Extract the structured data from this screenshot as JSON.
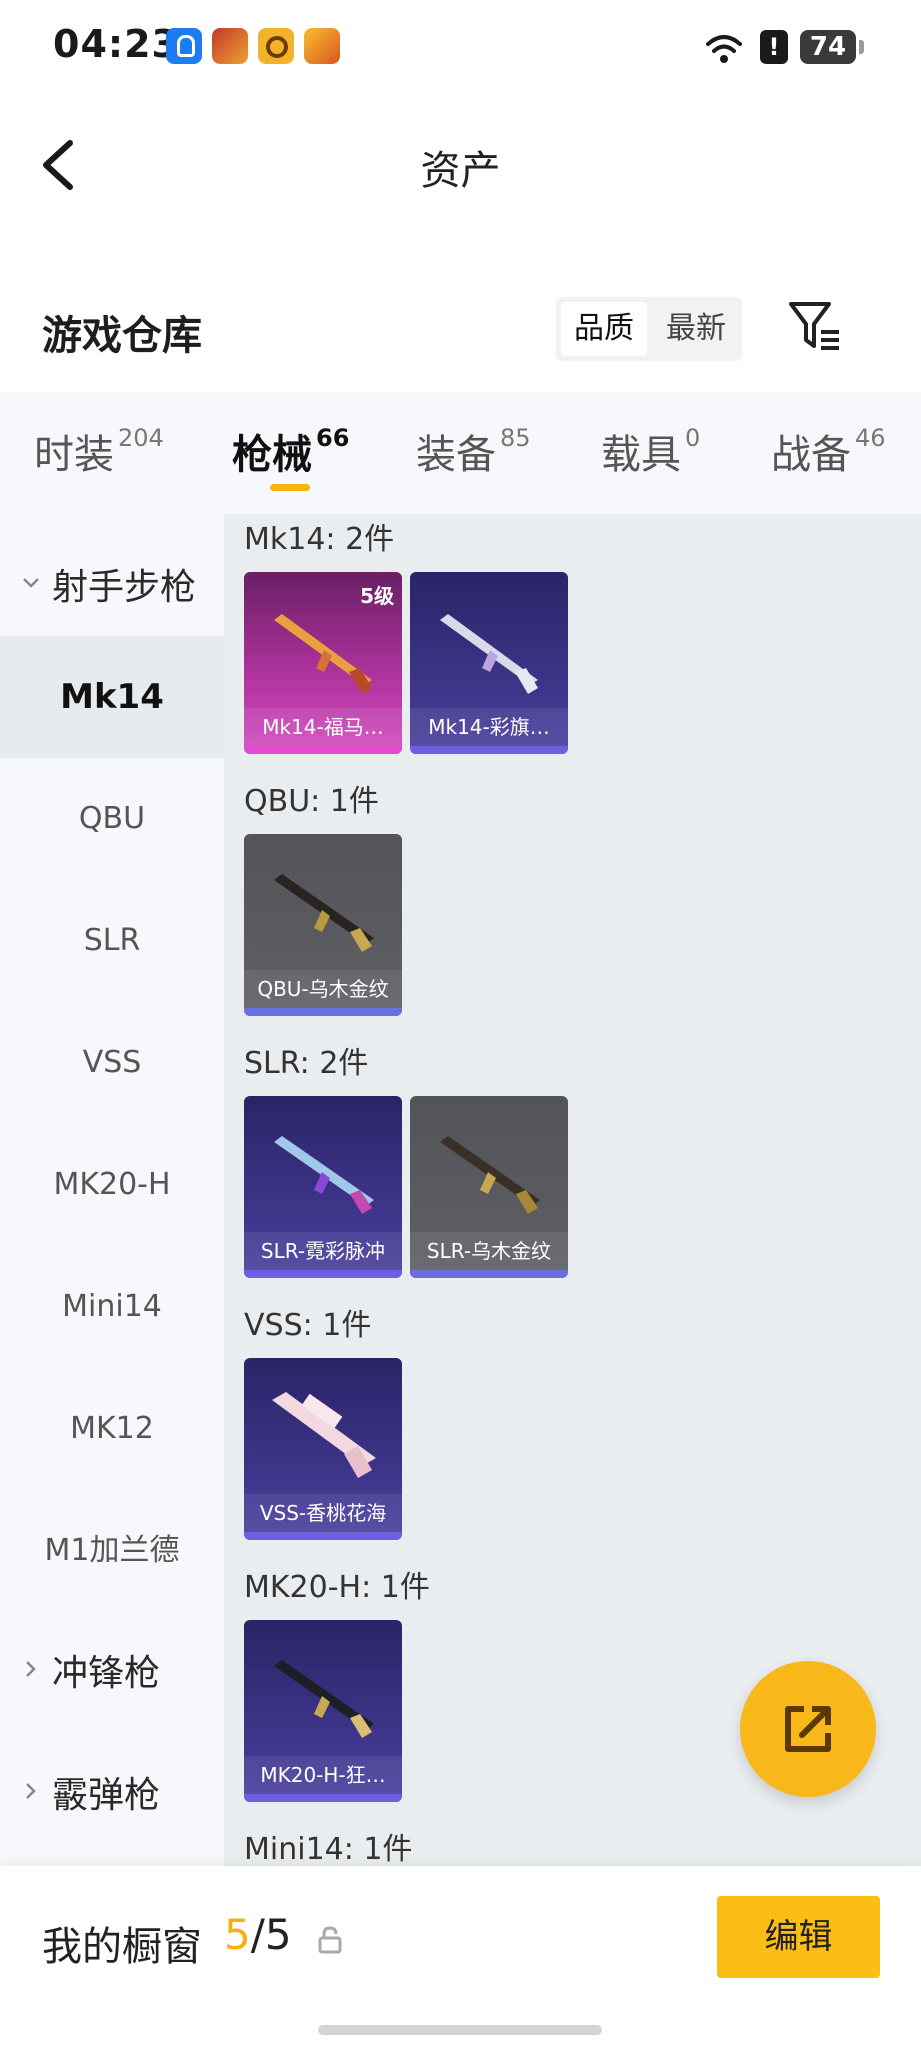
{
  "status_bar": {
    "time": "04:23",
    "battery": "74",
    "alert": "!"
  },
  "header": {
    "title": "资产"
  },
  "section": {
    "title": "游戏仓库",
    "sort_options": [
      "品质",
      "最新"
    ],
    "sort_selected": "品质"
  },
  "tabs": [
    {
      "label": "时装",
      "count": "204"
    },
    {
      "label": "枪械",
      "count": "66"
    },
    {
      "label": "装备",
      "count": "85"
    },
    {
      "label": "载具",
      "count": "0"
    },
    {
      "label": "战备",
      "count": "46"
    }
  ],
  "active_tab": "枪械",
  "sidebar": {
    "groups": [
      {
        "label": "射手步枪",
        "expanded": true
      },
      {
        "label": "冲锋枪",
        "expanded": false
      },
      {
        "label": "霰弹枪",
        "expanded": false
      }
    ],
    "items": [
      "Mk14",
      "QBU",
      "SLR",
      "VSS",
      "MK20-H",
      "Mini14",
      "MK12",
      "M1加兰德"
    ],
    "active_item": "Mk14"
  },
  "groups": [
    {
      "title": "Mk14: 2件",
      "items": [
        {
          "name": "Mk14-福马…",
          "badge": "5级",
          "style": "pink"
        },
        {
          "name": "Mk14-彩旗…",
          "style": "purple"
        }
      ]
    },
    {
      "title": "QBU: 1件",
      "items": [
        {
          "name": "QBU-乌木金纹",
          "style": "gray"
        }
      ]
    },
    {
      "title": "SLR: 2件",
      "items": [
        {
          "name": "SLR-霓彩脉冲",
          "style": "purple"
        },
        {
          "name": "SLR-乌木金纹",
          "style": "gray"
        }
      ]
    },
    {
      "title": "VSS: 1件",
      "items": [
        {
          "name": "VSS-香桃花海",
          "style": "purple"
        }
      ]
    },
    {
      "title": "MK20-H: 1件",
      "items": [
        {
          "name": "MK20-H-狂…",
          "style": "purple"
        }
      ]
    },
    {
      "title": "Mini14: 1件",
      "items": []
    }
  ],
  "showcase": {
    "label": "我的橱窗",
    "current": "5",
    "separator": "/",
    "total": "5",
    "edit_label": "编辑"
  },
  "colors": {
    "accent": "#f5b50b",
    "fab": "#f8b81a",
    "edit_button": "#fcbd14"
  },
  "icons": [
    "back-arrow-icon",
    "filter-icon",
    "share-icon",
    "lock-icon",
    "chevron-down-icon",
    "chevron-right-icon"
  ]
}
